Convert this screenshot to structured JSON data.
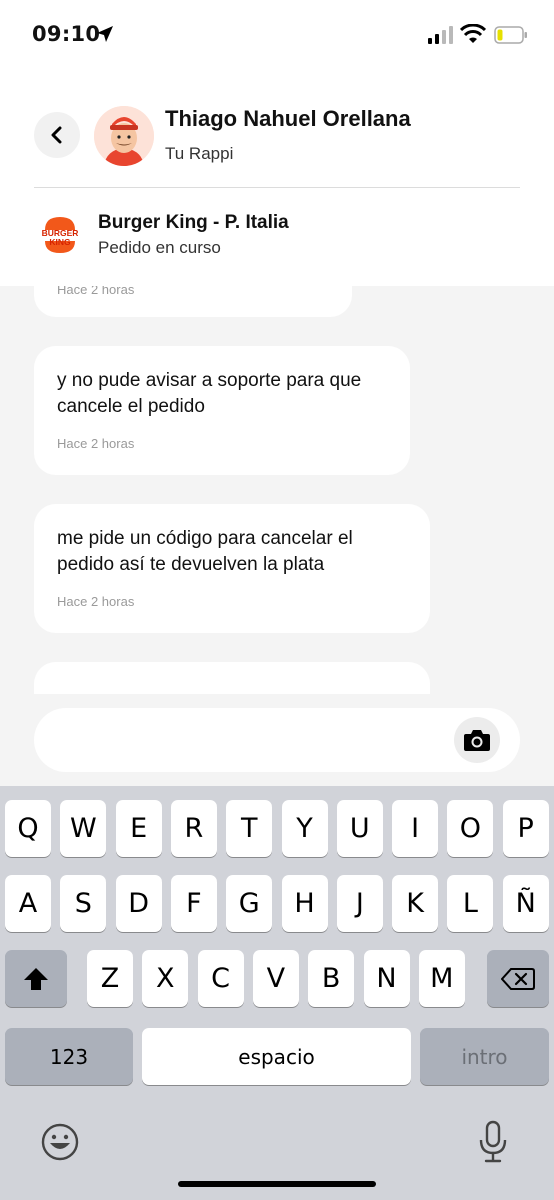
{
  "status_bar": {
    "time": "09:10",
    "icons": [
      "location-arrow-icon",
      "signal-icon",
      "wifi-icon",
      "battery-icon"
    ]
  },
  "header": {
    "courier_name": "Thiago Nahuel Orellana",
    "courier_role": "Tu Rappi",
    "store_name": "Burger King - P. Italia",
    "order_status": "Pedido en curso",
    "store_logo_text": [
      "BURGER",
      "KING"
    ]
  },
  "messages": [
    {
      "text": "",
      "time": "Hace 2 horas"
    },
    {
      "text": "y no pude avisar a soporte para que cancele el pedido",
      "time": "Hace 2 horas"
    },
    {
      "text": "me pide un código para cancelar el pedido así te devuelven la plata",
      "time": "Hace 2 horas"
    }
  ],
  "composer": {
    "placeholder": ""
  },
  "keyboard": {
    "row1": [
      "Q",
      "W",
      "E",
      "R",
      "T",
      "Y",
      "U",
      "I",
      "O",
      "P"
    ],
    "row2": [
      "A",
      "S",
      "D",
      "F",
      "G",
      "H",
      "J",
      "K",
      "L",
      "Ñ"
    ],
    "row3": [
      "Z",
      "X",
      "C",
      "V",
      "B",
      "N",
      "M"
    ],
    "numbers_label": "123",
    "space_label": "espacio",
    "return_label": "intro"
  },
  "colors": {
    "accent_logo_orange": "#f2581a",
    "logo_red": "#d62300",
    "background": "#f4f4f4",
    "keyboard_bg": "#d1d3d9"
  }
}
